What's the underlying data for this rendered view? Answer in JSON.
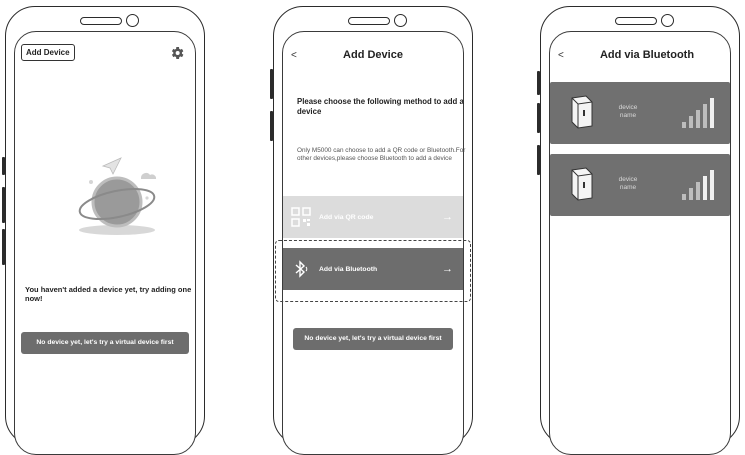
{
  "phone1": {
    "add_device_label": "Add Device",
    "settings_icon": "gear-icon",
    "empty_message": "You haven't added a device yet, try adding one now!",
    "virtual_button_label": "No device yet, let's try a virtual device first"
  },
  "phone2": {
    "back_label": "<",
    "title": "Add Device",
    "choose_text": "Please choose the following method to add a device",
    "note_text": "Only M5000 can choose to add a QR code or Bluetooth.For other devices,please choose Bluetooth to add a device",
    "qr_label": "Add via QR code",
    "bluetooth_label": "Add via Bluetooth",
    "arrow": "→",
    "virtual_button_label": "No device yet, let's try a virtual device first"
  },
  "phone3": {
    "back_label": "<",
    "title": "Add via Bluetooth",
    "devices": [
      {
        "name": "device name"
      },
      {
        "name": "device name"
      }
    ]
  }
}
